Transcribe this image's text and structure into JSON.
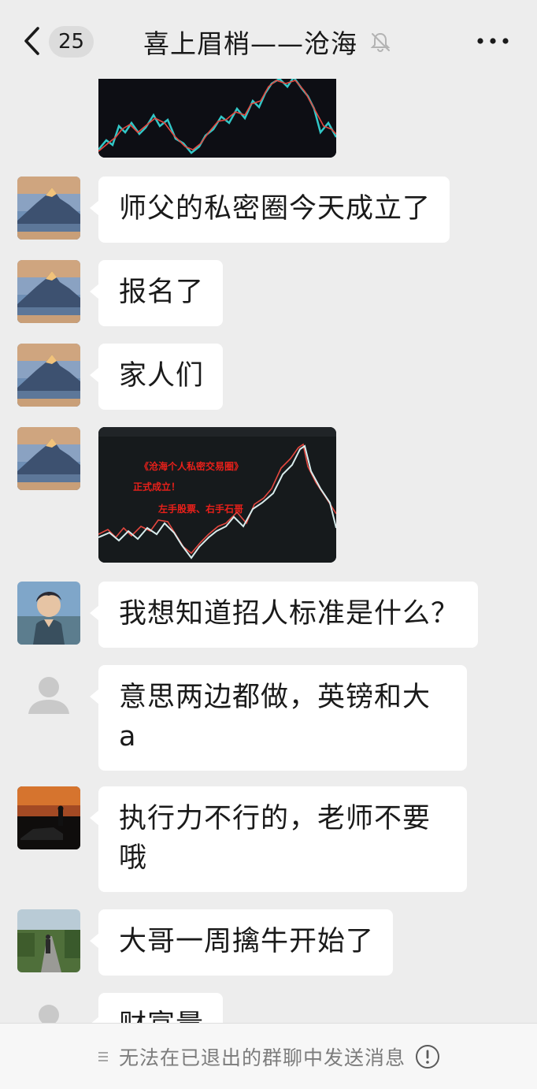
{
  "header": {
    "unread_count": "25",
    "title": "喜上眉梢——沧海"
  },
  "messages": [
    {
      "type": "image",
      "caption_lines": []
    },
    {
      "type": "text",
      "text": "师父的私密圈今天成立了"
    },
    {
      "type": "text",
      "text": "报名了"
    },
    {
      "type": "text",
      "text": "家人们"
    },
    {
      "type": "image",
      "caption_lines": [
        "《沧海个人私密交易圈》",
        "正式成立！",
        "左手股票、右手石哥"
      ]
    },
    {
      "type": "text",
      "text": "我想知道招人标准是什么？"
    },
    {
      "type": "text",
      "text": "意思两边都做，英镑和大a"
    },
    {
      "type": "text",
      "text": "执行力不行的，老师不要哦"
    },
    {
      "type": "text",
      "text": "大哥一周擒牛开始了"
    },
    {
      "type": "text",
      "text": "财富量"
    }
  ],
  "footer": {
    "notice": "无法在已退出的群聊中发送消息"
  },
  "colors": {
    "background": "#ededed",
    "bubble": "#ffffff",
    "chart_up": "#e5473f",
    "chart_down": "#32c7c7",
    "image_caption": "#e8201a"
  }
}
